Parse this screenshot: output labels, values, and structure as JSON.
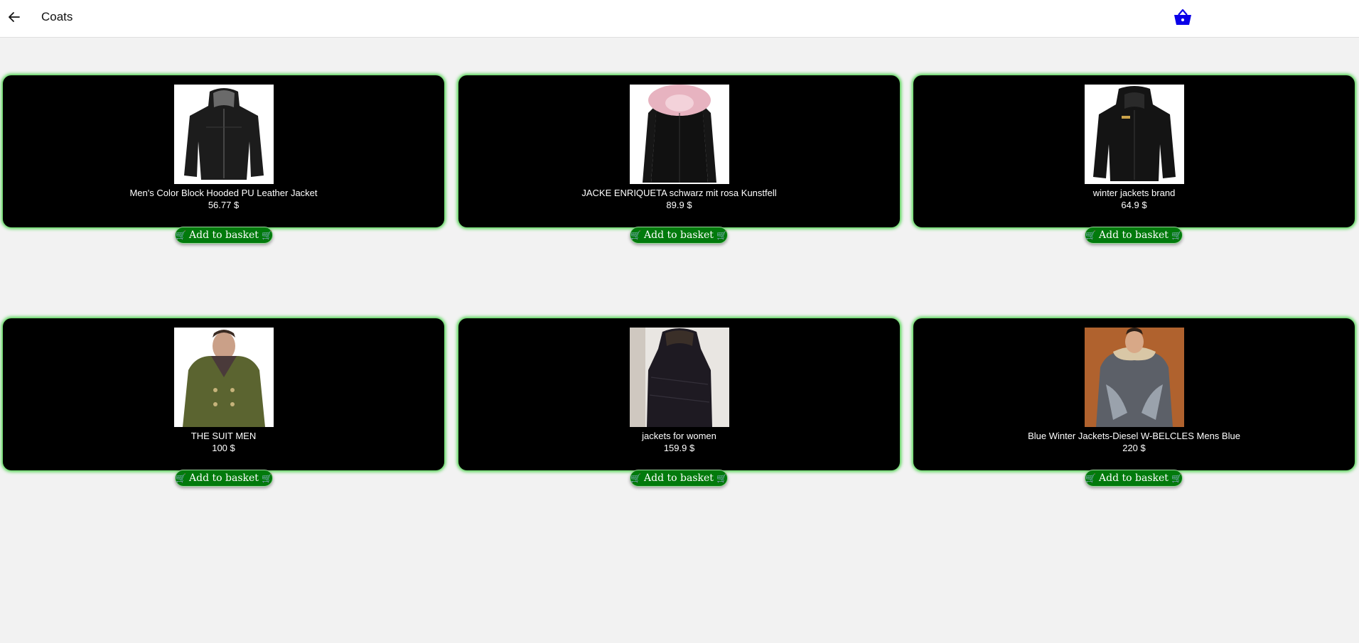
{
  "header": {
    "title": "Coats",
    "back_icon": "arrow-left-icon",
    "basket_icon": "basket-icon"
  },
  "colors": {
    "card_bg": "#000000",
    "card_glow": "#49d349",
    "button_bg": "#027a0c",
    "basket": "#0a00e8",
    "page_bg": "#f2f2f2"
  },
  "products": [
    {
      "name": "Men's Color Block Hooded PU Leather Jacket",
      "price": "56.77 $",
      "button": "Add to basket"
    },
    {
      "name": "JACKE ENRIQUETA schwarz mit rosa Kunstfell",
      "price": "89.9 $",
      "button": "Add to basket"
    },
    {
      "name": "winter jackets brand",
      "price": "64.9 $",
      "button": "Add to basket"
    },
    {
      "name": "THE SUIT MEN",
      "price": "100 $",
      "button": "Add to basket"
    },
    {
      "name": "jackets for women",
      "price": "159.9 $",
      "button": "Add to basket"
    },
    {
      "name": "Blue Winter Jackets-Diesel W-BELCLES Mens Blue",
      "price": "220 $",
      "button": "Add to basket"
    }
  ]
}
